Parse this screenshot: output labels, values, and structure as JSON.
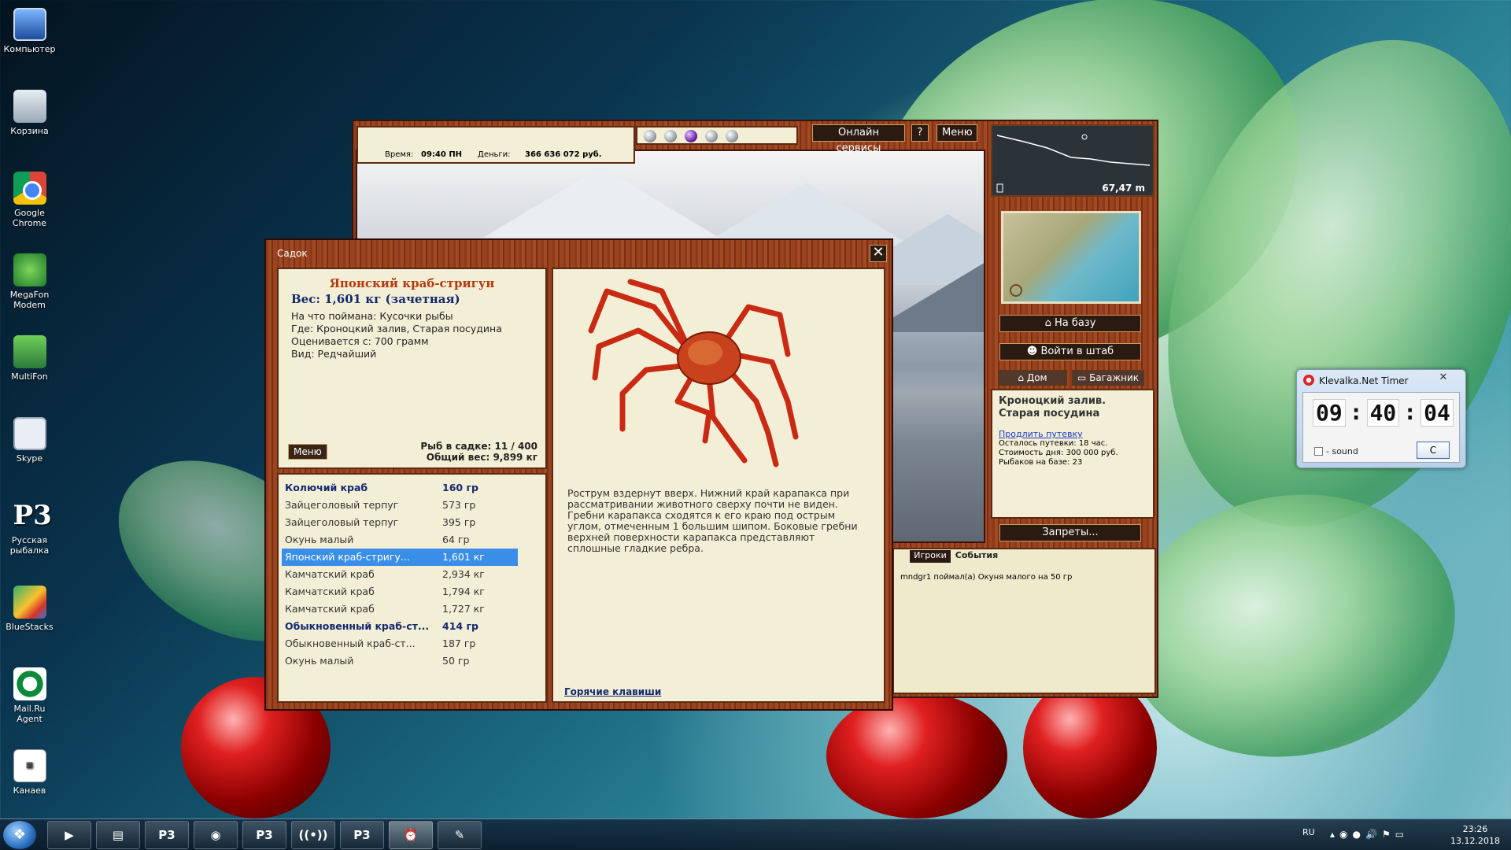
{
  "desktop": {
    "icons": [
      {
        "label": "Компьютер",
        "icon": "computer-icon"
      },
      {
        "label": "Корзина",
        "icon": "recycle-bin-icon"
      },
      {
        "label": "Google Chrome",
        "icon": "chrome-icon"
      },
      {
        "label": "MegaFon Modem",
        "icon": "megafon-icon"
      },
      {
        "label": "MultiFon",
        "icon": "multifon-icon"
      },
      {
        "label": "Skype",
        "icon": "skype-icon"
      },
      {
        "label": "Русская рыбалка",
        "icon": "russian-fishing-icon"
      },
      {
        "label": "BlueStacks",
        "icon": "bluestacks-icon"
      },
      {
        "label": "Mail.Ru Agent",
        "icon": "mailru-agent-icon"
      },
      {
        "label": "Канаев",
        "icon": "document-icon"
      }
    ]
  },
  "game": {
    "time_label": "Время:",
    "time_value": "09:40 ПН",
    "money_label": "Деньги:",
    "money_value": "366 636 072 руб.",
    "online_services": "Онлайн сервисы",
    "help": "?",
    "menu": "Меню",
    "depth": "67,47 m",
    "to_base": "На базу",
    "enter_hq": "Войти в штаб",
    "home_tab": "Дом",
    "trunk_tab": "Багажник",
    "location_title": "Кроноцкий залив. Старая посудина",
    "extend_trip": "Продлить путевку",
    "trip_left": "Осталось путевки: 18 час.",
    "day_cost": "Стоимость дня: 300 000 руб.",
    "fishers_on_base": "Рыбаков на базе: 23",
    "prohibitions": "Запреты...",
    "chat_tab_players": "Игроки",
    "chat_tab_events": "События",
    "chat_message": "mndgr1 поймал(а) Окуня малого на 50 гр"
  },
  "sadok": {
    "title": "Садок",
    "close": "✕",
    "fish_name": "Японский краб-стригун",
    "fish_weight": "Вес: 1,601 кг (зачетная)",
    "caught_on": "На что поймана: Кусочки рыбы",
    "where": "Где: Кроноцкий залив, Старая посудина",
    "rated_from": "Оценивается с: 700 грамм",
    "kind": "Вид: Редчайший",
    "menu_button": "Меню",
    "fish_in_sadok": "Рыб в садке: 11 / 400",
    "total_weight": "Общий вес: 9,899 кг",
    "fish_list": [
      {
        "name": "Колючий краб",
        "weight": "160 гр",
        "style": "bold"
      },
      {
        "name": "Зайцеголовый терпуг",
        "weight": "573 гр",
        "style": ""
      },
      {
        "name": "Зайцеголовый терпуг",
        "weight": "395 гр",
        "style": ""
      },
      {
        "name": "Окунь малый",
        "weight": "64 гр",
        "style": ""
      },
      {
        "name": "Японский краб-стригу...",
        "weight": "1,601 кг",
        "style": "sel"
      },
      {
        "name": "Камчатский краб",
        "weight": "2,934 кг",
        "style": ""
      },
      {
        "name": "Камчатский краб",
        "weight": "1,794 кг",
        "style": ""
      },
      {
        "name": "Камчатский краб",
        "weight": "1,727 кг",
        "style": ""
      },
      {
        "name": "Обыкновенный краб-ст...",
        "weight": "414 гр",
        "style": "bold"
      },
      {
        "name": "Обыкновенный краб-ст...",
        "weight": "187 гр",
        "style": ""
      },
      {
        "name": "Окунь малый",
        "weight": "50 гр",
        "style": ""
      }
    ],
    "description": "Рострум вздернут вверх. Нижний край карапакса при рассматривании животного сверху почти не виден. Гребни карапакса сходятся к его краю под острым углом, отмеченным 1 большим шипом. Боковые гребни верхней поверхности карапакса представляют сплошные гладкие ребра.",
    "hotkeys": "Горячие клавиши"
  },
  "timer": {
    "title": "Klevalka.Net Timer",
    "close": "✕",
    "hours": "09",
    "minutes": "40",
    "seconds": "04",
    "sound_label": "- sound",
    "c_button": "C"
  },
  "taskbar": {
    "lang": "RU",
    "time": "23:26",
    "date": "13.12.2018",
    "rr_label": "Р3"
  }
}
